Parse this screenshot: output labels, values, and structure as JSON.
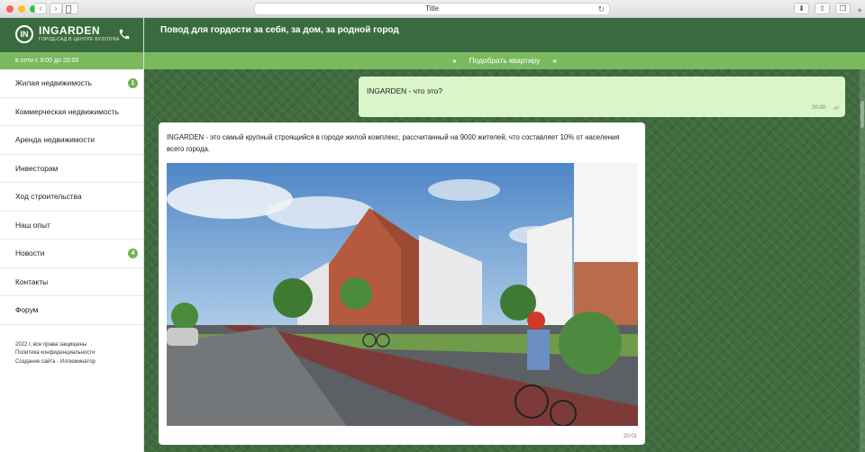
{
  "browser": {
    "title": "Title",
    "controls": [
      "close",
      "minimize",
      "maximize"
    ]
  },
  "brand": {
    "logo_mark": "IN",
    "name": "INGARDEN",
    "tagline": "ГОРОД-САД В ЦЕНТРЕ БУЗУЛУКА"
  },
  "header": {
    "title": "Повод для гордости за себя, за дом, за родной город",
    "hours": "в сети с 9:00 до 20:00",
    "cta_prev": "»",
    "cta_label": "Подобрать квартиру",
    "cta_next": "«"
  },
  "menu": [
    {
      "label": "Жилая недвижимость",
      "badge": "1"
    },
    {
      "label": "Коммерческая недвижимость",
      "badge": ""
    },
    {
      "label": "Аренда недвижимости",
      "badge": ""
    },
    {
      "label": "Инвесторам",
      "badge": ""
    },
    {
      "label": "Ход строительства",
      "badge": ""
    },
    {
      "label": "Наш опыт",
      "badge": ""
    },
    {
      "label": "Новости",
      "badge": "4"
    },
    {
      "label": "Контакты",
      "badge": ""
    },
    {
      "label": "Форум",
      "badge": ""
    }
  ],
  "footer": {
    "copyright": "2022 г, все права защищены",
    "privacy": "Политика конфиденциальности",
    "credit": "Создание сайта - Иллюминатор"
  },
  "messages": {
    "user": {
      "text": "INGARDEN - что это?",
      "time": "20:00"
    },
    "bot": {
      "text": "INGARDEN - это самый крупный строящийся в городе жилой комплекс, рассчитанный на 9000 жителей, что составляет 10% от населения всего города.",
      "time": "20:01"
    }
  },
  "colors": {
    "brand_dark": "#3a6b40",
    "brand_light": "#7bb95f",
    "user_bubble": "#daf5c8",
    "badge": "#6fb35a"
  }
}
